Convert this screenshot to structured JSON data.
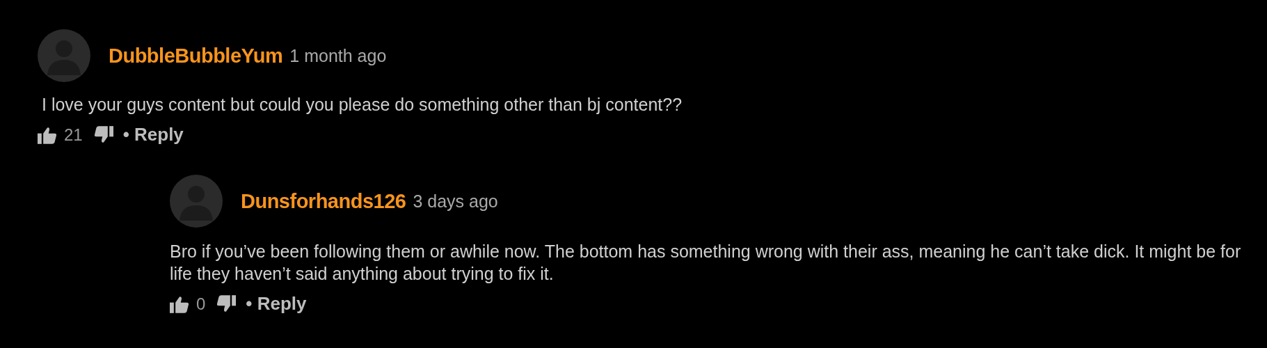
{
  "comments": [
    {
      "username": "DubbleBubbleYum",
      "time": "1 month ago",
      "text": "I love your guys content but could you please do something other than bj content??",
      "likes": "21",
      "reply_label": "• Reply",
      "children": [
        {
          "username": "Dunsforhands126",
          "time": "3 days ago",
          "text": "Bro if you’ve been following them or awhile now. The bottom has something wrong with their ass, meaning he can’t take dick. It might be for life they haven’t said anything about trying to fix it.",
          "likes": "0",
          "reply_label": "• Reply"
        }
      ]
    }
  ]
}
